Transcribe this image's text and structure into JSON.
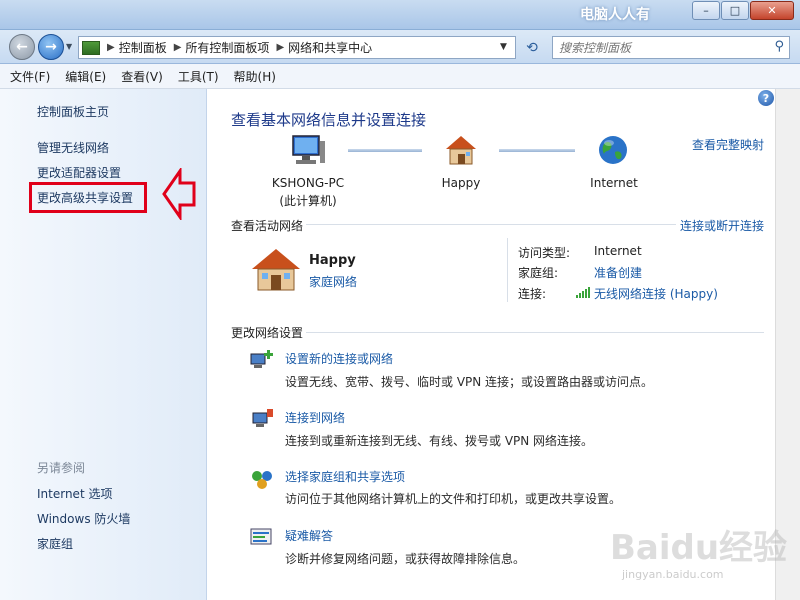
{
  "window": {
    "watermark_title": "电脑人人有",
    "min": "–",
    "max": "□",
    "close": "✕"
  },
  "address": {
    "crumbs": [
      "控制面板",
      "所有控制面板项",
      "网络和共享中心"
    ],
    "search_placeholder": "搜索控制面板"
  },
  "menu": [
    "文件(F)",
    "编辑(E)",
    "查看(V)",
    "工具(T)",
    "帮助(H)"
  ],
  "sidebar": {
    "home": "控制面板主页",
    "links": [
      "管理无线网络",
      "更改适配器设置",
      "更改高级共享设置"
    ],
    "see_also_title": "另请参阅",
    "see_also": [
      "Internet 选项",
      "Windows 防火墙",
      "家庭组"
    ]
  },
  "main": {
    "title": "查看基本网络信息并设置连接",
    "full_map": "查看完整映射",
    "nodes": [
      {
        "name": "KSHONG-PC",
        "sub": "(此计算机)"
      },
      {
        "name": "Happy"
      },
      {
        "name": "Internet"
      }
    ],
    "active_title": "查看活动网络",
    "connect_link": "连接或断开连接",
    "network": {
      "name": "Happy",
      "type": "家庭网络",
      "access_label": "访问类型:",
      "access_value": "Internet",
      "homegroup_label": "家庭组:",
      "homegroup_value": "准备创建",
      "conn_label": "连接:",
      "conn_value": "无线网络连接 (Happy)"
    },
    "change_title": "更改网络设置",
    "tasks": [
      {
        "title": "设置新的连接或网络",
        "desc": "设置无线、宽带、拨号、临时或 VPN 连接；或设置路由器或访问点。"
      },
      {
        "title": "连接到网络",
        "desc": "连接到或重新连接到无线、有线、拨号或 VPN 网络连接。"
      },
      {
        "title": "选择家庭组和共享选项",
        "desc": "访问位于其他网络计算机上的文件和打印机，或更改共享设置。"
      },
      {
        "title": "疑难解答",
        "desc": "诊断并修复网络问题，或获得故障排除信息。"
      }
    ]
  },
  "watermark": {
    "logo": "Baidu经验",
    "url": "jingyan.baidu.com"
  },
  "colors": {
    "link": "#1a5aa6",
    "highlight": "#e0001a"
  }
}
